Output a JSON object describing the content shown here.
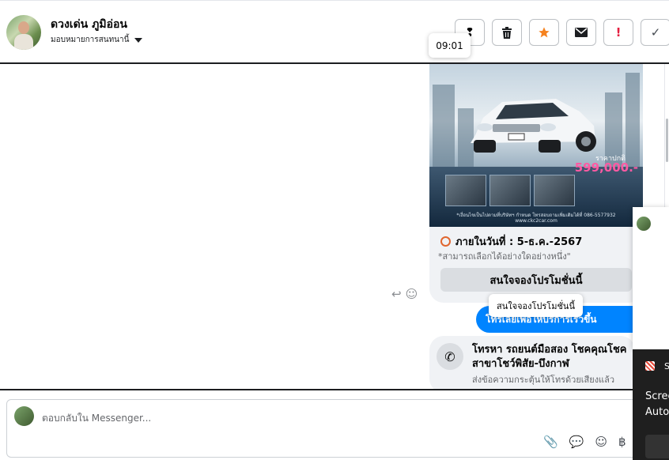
{
  "header": {
    "user_name": "ดวงเด่น ภูมิอ่อน",
    "assign_label": "มอบหมายการสนทนานี้",
    "toolbar": [
      {
        "name": "follow-up-icon",
        "glyph": "❢"
      },
      {
        "name": "trash-icon",
        "glyph": "🗑"
      },
      {
        "name": "star-icon",
        "glyph": "★"
      },
      {
        "name": "mail-icon",
        "glyph": "✉"
      },
      {
        "name": "spam-icon",
        "glyph": "!"
      },
      {
        "name": "check-icon",
        "glyph": "✓"
      }
    ],
    "time_tooltip": "09:01"
  },
  "promo": {
    "price_label": "ราคาปกติ",
    "price": "599,000.-",
    "fine_print": "*เงื่อนไขเป็นไปตามที่บริษัทฯ กำหนด โทรสอบถามเพิ่มเติมได้ที่ 086-5577932",
    "website": "www.ckc2car.com",
    "deadline": "ภายในวันที่ : 5-ธ.ค.-2567",
    "note": "*สามารถเลือกได้อย่างใดอย่างหนึ่ง\"",
    "cta": "สนใจจองโปรโมชั่นนี้",
    "cta_tooltip": "สนใจจองโปรโมชั่นนี้"
  },
  "messages": {
    "blue_bubble": "โทรเลยเพื่อให้บริการเร็วขึ้น",
    "call_title": "โทรหา รถยนต์มือสอง โชคคุณโชค สาขาโชว์พิสัย-บึงกาฬ",
    "call_sub": "ส่งข้อความกระตุ้นให้โทรด้วยเสียงแล้ว"
  },
  "composer": {
    "placeholder": "ตอบกลับใน Messenger..."
  },
  "toast": {
    "app_letter": "S",
    "line1": "Scree",
    "line2": "Auto"
  },
  "colors": {
    "accent": "#0084ff",
    "price": "#ff5aa3",
    "star": "#f5821f",
    "spam": "#e41e3f"
  }
}
